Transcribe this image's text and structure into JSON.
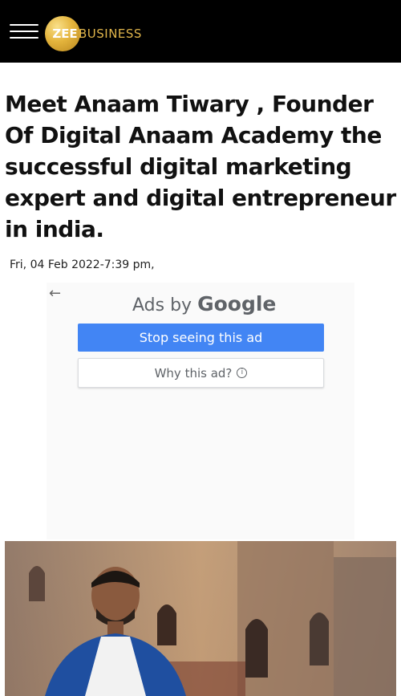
{
  "header": {
    "logo_prefix": "ZEE",
    "logo_suffix": "BUSINESS",
    "menu_icon": "hamburger-menu-icon"
  },
  "article": {
    "headline": "Meet Anaam Tiwary , Founder Of Digital Anaam Academy the successful digital marketing expert and digital entrepreneur in india.",
    "date": "Fri, 04 Feb 2022-7:39 pm,"
  },
  "ad": {
    "back_icon": "back-arrow-icon",
    "ads_by": "Ads by",
    "brand": "Google",
    "stop_label": "Stop seeing this ad",
    "why_label": "Why this ad?",
    "info_glyph": "i"
  },
  "colors": {
    "header_bg": "#000000",
    "logo_gold": "#e0b54b",
    "ad_button_blue": "#4285f4"
  }
}
